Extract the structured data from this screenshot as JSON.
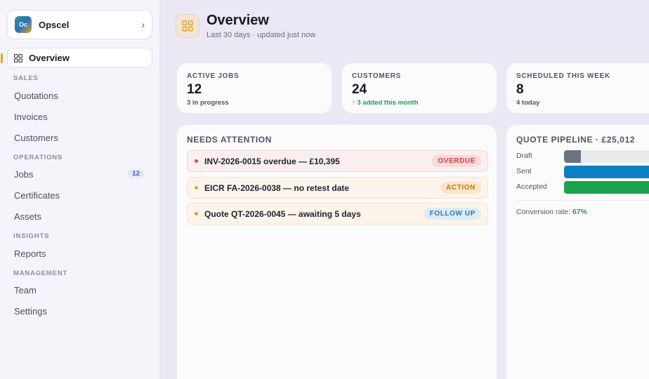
{
  "sidebar": {
    "org_initials": "Oc",
    "org_name": "Opscel",
    "active_item": "Overview",
    "sections": [
      {
        "label": "SALES",
        "items": [
          "Quotations",
          "Invoices",
          "Customers"
        ]
      },
      {
        "label": "OPERATIONS",
        "items": [
          "Jobs",
          "Certificates",
          "Assets"
        ]
      },
      {
        "label": "INSIGHTS",
        "items": [
          "Reports"
        ]
      },
      {
        "label": "MANAGEMENT",
        "items": [
          "Team",
          "Settings"
        ]
      }
    ],
    "jobs_badge": "12"
  },
  "header": {
    "title": "Overview",
    "subtitle": "Last 30 days · updated just now"
  },
  "stats": [
    {
      "label": "ACTIVE JOBS",
      "value": "12",
      "note": "3 in progress"
    },
    {
      "label": "CUSTOMERS",
      "value": "24",
      "note": "↑ 3 added this month"
    },
    {
      "label": "SCHEDULED THIS WEEK",
      "value": "8",
      "note": "4 today"
    }
  ],
  "attention": {
    "title": "NEEDS ATTENTION",
    "items": [
      {
        "text": "INV-2026-0015 overdue — £10,395",
        "status": "OVERDUE"
      },
      {
        "text": "EICR FA-2026-0038 — no retest date",
        "status": "ACTION"
      },
      {
        "text": "Quote QT-2026-0045 — awaiting 5 days",
        "status": "FOLLOW UP"
      }
    ]
  },
  "pipeline": {
    "title": "QUOTE PIPELINE · £25,012",
    "rows": [
      {
        "label": "Draft",
        "fill": 0.17,
        "color": "#6b7280"
      },
      {
        "label": "Sent",
        "fill": 1.0,
        "color": "#0a7fc4"
      },
      {
        "label": "Accepted",
        "fill": 1.0,
        "color": "#1aa34a"
      }
    ],
    "conversion_label": "Conversion rate:",
    "conversion_value": "67%"
  },
  "colors": {
    "accent": "#e2a72c",
    "overdue": "#d2413f",
    "action": "#c57516",
    "follow_up": "#2a7bb6",
    "positive": "#1f9d4d"
  }
}
